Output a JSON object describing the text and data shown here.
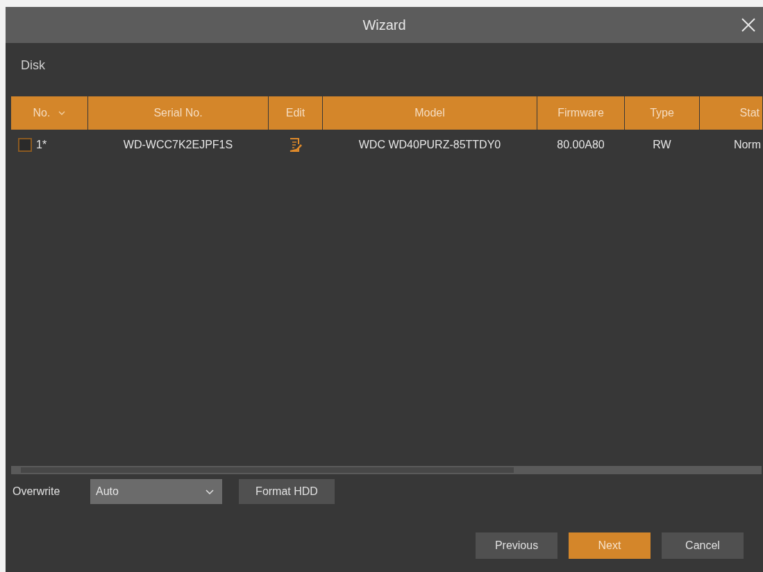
{
  "window": {
    "title": "Wizard"
  },
  "section": {
    "title": "Disk"
  },
  "table": {
    "columns": [
      {
        "label": "No.",
        "sortable": true
      },
      {
        "label": "Serial No.",
        "sortable": false
      },
      {
        "label": "Edit",
        "sortable": false
      },
      {
        "label": "Model",
        "sortable": false
      },
      {
        "label": "Firmware",
        "sortable": false
      },
      {
        "label": "Type",
        "sortable": false
      },
      {
        "label": "Stat",
        "sortable": false
      }
    ],
    "rows": [
      {
        "checked": false,
        "no": "1*",
        "serial": "WD-WCC7K2EJPF1S",
        "model": "WDC WD40PURZ-85TTDY0",
        "firmware": "80.00A80",
        "type": "RW",
        "status": "Norm"
      }
    ]
  },
  "overwrite": {
    "label": "Overwrite",
    "value": "Auto"
  },
  "format_button": "Format HDD",
  "buttons": [
    {
      "label": "Previous",
      "kind": "normal"
    },
    {
      "label": "Next",
      "kind": "primary"
    },
    {
      "label": "Cancel",
      "kind": "normal"
    }
  ]
}
